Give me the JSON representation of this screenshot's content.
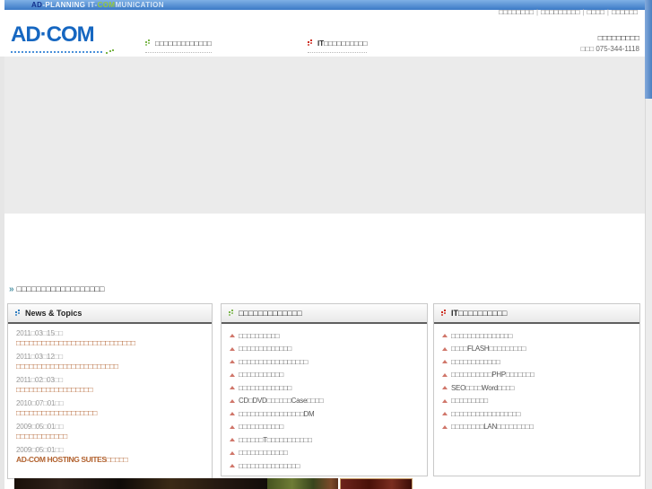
{
  "topbar": {
    "brand_segments": [
      {
        "text": "AD",
        "color": "#15338f"
      },
      {
        "text": "-PLANNING ",
        "color": "#f2f7fc"
      },
      {
        "text": "IT-",
        "color": "#d7e6f6"
      },
      {
        "text": "COM",
        "color": "#97c93d"
      },
      {
        "text": "MUNICATION",
        "color": "#d7e6f6"
      }
    ]
  },
  "utility": {
    "links": [
      "□□□□□□□□",
      "□□□□□□□□□",
      "□□□□",
      "□□□□□□"
    ],
    "separator": "|"
  },
  "header": {
    "logo": "AD·COM",
    "nav": [
      {
        "label": "□□□□□□□□□□□□□"
      },
      {
        "label": "IT□□□□□□□□□□"
      }
    ],
    "contact_line1": "□□□□□□□□□",
    "contact_line2": "□□□ 075-344-1118"
  },
  "headline": "□□□□□□□□□□□□□□□□□□",
  "news": {
    "title": "News & Topics",
    "items": [
      {
        "date": "2011□03□15□□",
        "text": "□□□□□□□□□□□□□□□□□□□□□□□□□□□□"
      },
      {
        "date": "2011□03□12□□",
        "text": "□□□□□□□□□□□□□□□□□□□□□□□□"
      },
      {
        "date": "2011□02□03□□",
        "text": "□□□□□□□□□□□□□□□□□□"
      },
      {
        "date": "2010□07□01□□",
        "text": "□□□□□□□□□□□□□□□□□□□"
      },
      {
        "date": "2009□05□01□□",
        "text": "□□□□□□□□□□□□"
      },
      {
        "date": "2009□05□01□□",
        "text": "AD-COM HOSTING SUITES□□□□□"
      }
    ]
  },
  "services": {
    "title": "□□□□□□□□□□□□□",
    "items": [
      "□□□□□□□□□□",
      "□□□□□□□□□□□□□",
      "□□□□□□□□□□□□□□□□□",
      "□□□□□□□□□□□",
      "□□□□□□□□□□□□□",
      "CD□DVD□□□□□□Case□□□□",
      "□□□□□□□□□□□□□□□□DM",
      "□□□□□□□□□□□",
      "□□□□□□T□□□□□□□□□□□",
      "□□□□□□□□□□□□",
      "□□□□□□□□□□□□□□□"
    ]
  },
  "it": {
    "title": "IT□□□□□□□□□□",
    "items": [
      "□□□□□□□□□□□□□□□",
      "□□□□FLASH□□□□□□□□□",
      "□□□□□□□□□□□□",
      "□□□□□□□□□□PHP□□□□□□□",
      "SEO□□□□Word□□□□",
      "□□□□□□□□□",
      "□□□□□□□□□□□□□□□□□",
      "□□□□□□□□LAN□□□□□□□□□"
    ]
  },
  "footer_strip": {
    "photos": [
      "dark-interior-collage",
      "green-garden-photo",
      "framed-red-artwork"
    ]
  },
  "colors": {
    "brand_blue": "#1667c1",
    "bar_blue": "#3b7ac6",
    "accent_green": "#7ab648",
    "accent_red": "#cc2b1d",
    "news_blue": "#2b7bbf",
    "link_orange": "#b2622f"
  }
}
